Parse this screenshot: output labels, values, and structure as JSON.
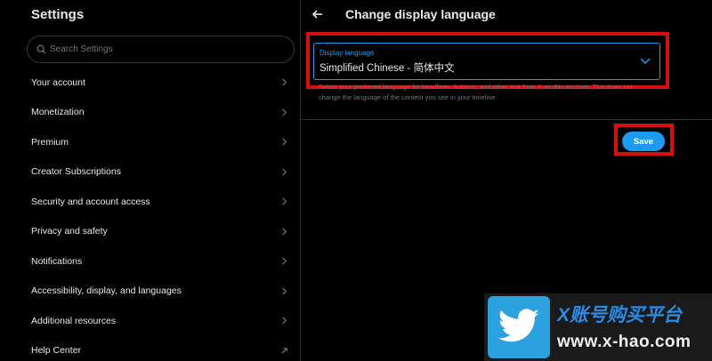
{
  "sidebar": {
    "title": "Settings",
    "search_placeholder": "Search Settings",
    "items": [
      {
        "label": "Your account",
        "icon": "chevron-right-icon"
      },
      {
        "label": "Monetization",
        "icon": "chevron-right-icon"
      },
      {
        "label": "Premium",
        "icon": "chevron-right-icon"
      },
      {
        "label": "Creator Subscriptions",
        "icon": "chevron-right-icon"
      },
      {
        "label": "Security and account access",
        "icon": "chevron-right-icon"
      },
      {
        "label": "Privacy and safety",
        "icon": "chevron-right-icon"
      },
      {
        "label": "Notifications",
        "icon": "chevron-right-icon"
      },
      {
        "label": "Accessibility, display, and languages",
        "icon": "chevron-right-icon"
      },
      {
        "label": "Additional resources",
        "icon": "chevron-right-icon"
      },
      {
        "label": "Help Center",
        "icon": "external-link-icon"
      }
    ]
  },
  "main": {
    "title": "Change display language",
    "select": {
      "label": "Display language",
      "value": "Simplified Chinese - 简体中文"
    },
    "help_text": "Select your preferred language for headlines, buttons, and other text from X on this account. This does not change the language of the content you see in your timeline.",
    "save_label": "Save"
  },
  "watermark": {
    "top_text": "X账号购买平台",
    "bottom_text": "www.x-hao.com"
  },
  "colors": {
    "accent": "#1d9bf0",
    "highlight_box": "#d60f0f",
    "background": "#000000"
  }
}
